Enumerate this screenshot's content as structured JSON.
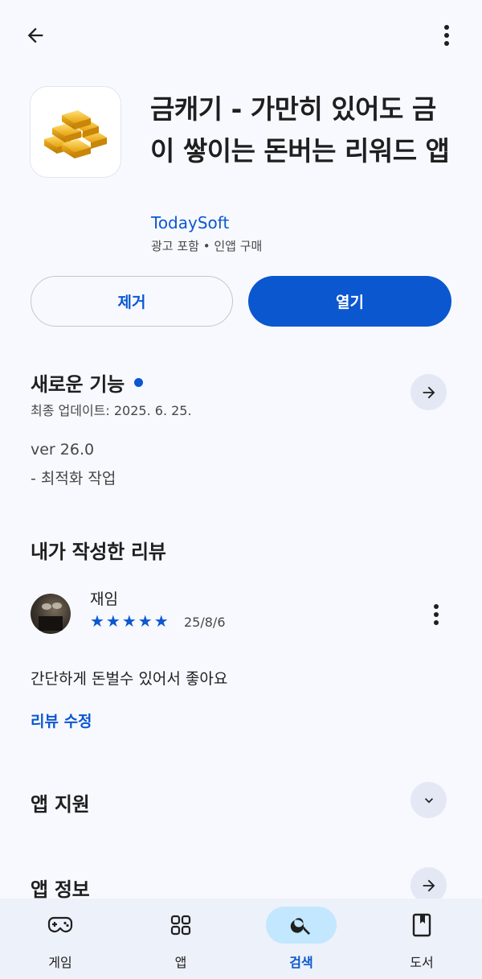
{
  "app": {
    "title": "금캐기 - 가만히 있어도 금이 쌓이는 돈버는 리워드 앱",
    "developer": "TodaySoft",
    "subtitle": "광고 포함 • 인앱 구매",
    "icon": "gold-bars-icon"
  },
  "actions": {
    "remove_label": "제거",
    "open_label": "열기"
  },
  "whats_new": {
    "heading": "새로운 기능",
    "updated": "최종 업데이트: 2025. 6. 25.",
    "version": "ver 26.0",
    "notes": "- 최적화 작업"
  },
  "my_review": {
    "heading": "내가 작성한 리뷰",
    "user": "재임",
    "rating": 5,
    "stars": "★★★★★",
    "date": "25/8/6",
    "text": "간단하게 돈벌수 있어서 좋아요",
    "edit_label": "리뷰 수정"
  },
  "sections": {
    "app_support": "앱 지원",
    "app_info": "앱 정보"
  },
  "nav": {
    "items": [
      {
        "label": "게임",
        "icon": "gamepad-icon",
        "active": false
      },
      {
        "label": "앱",
        "icon": "apps-grid-icon",
        "active": false
      },
      {
        "label": "검색",
        "icon": "search-icon",
        "active": true
      },
      {
        "label": "도서",
        "icon": "book-icon",
        "active": false
      }
    ]
  },
  "colors": {
    "accent": "#0b57d0",
    "background": "#f8f9ff",
    "nav_active": "#c2e7ff"
  }
}
